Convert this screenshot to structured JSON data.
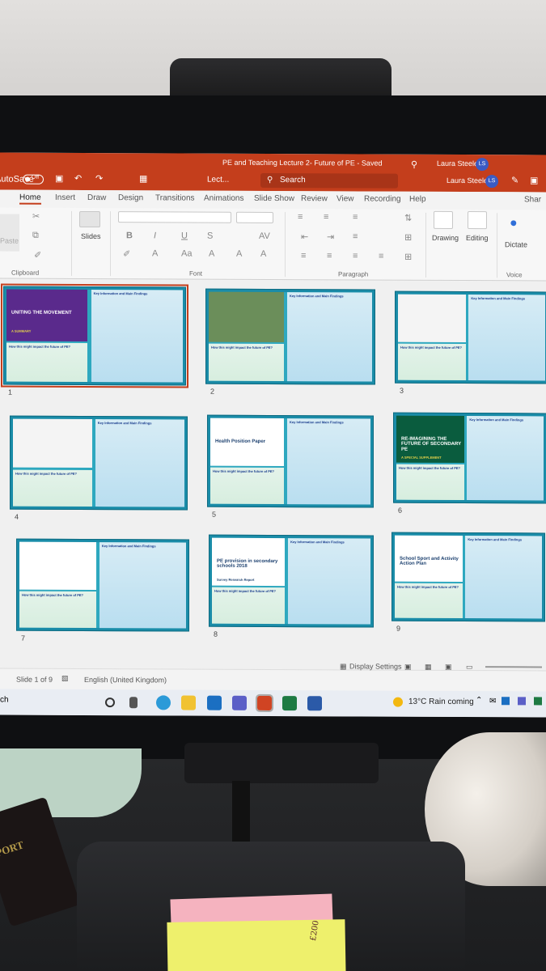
{
  "app": {
    "autosave_label": "AutoSave",
    "autosave_state": "Off",
    "doc_title": "PE and Teaching Lecture 2- Future of PE - Saved",
    "doc_dropdown": "Lect...",
    "search_placeholder": "Search",
    "user_name": "Laura Steele",
    "user_initials": "LS"
  },
  "ribbon": {
    "tabs": [
      "Home",
      "Insert",
      "Draw",
      "Design",
      "Transitions",
      "Animations",
      "Slide Show",
      "Review",
      "View",
      "Recording",
      "Help"
    ],
    "share_label": "Shar",
    "groups": {
      "clipboard": "Clipboard",
      "paste": "Paste",
      "slides": "Slides",
      "font": "Font",
      "paragraph": "Paragraph",
      "voice": "Voice"
    },
    "buttons": {
      "drawing": "Drawing",
      "editing": "Editing",
      "dictate": "Dictate"
    }
  },
  "slide_template": {
    "right_heading": "Key Information and Main Findings",
    "left_heading": "How this might impact the future of PE?"
  },
  "slides": [
    {
      "number": "1",
      "thumb_title": "UNITING THE MOVEMENT",
      "thumb_sub": "A SUMMARY"
    },
    {
      "number": "2",
      "thumb_title": "",
      "thumb_sub": ""
    },
    {
      "number": "3",
      "thumb_title": "",
      "thumb_sub": ""
    },
    {
      "number": "4",
      "thumb_title": "",
      "thumb_sub": ""
    },
    {
      "number": "5",
      "thumb_title": "Health Position Paper",
      "thumb_sub": ""
    },
    {
      "number": "6",
      "thumb_title": "RE-IMAGINING THE FUTURE OF SECONDARY PE",
      "thumb_sub": "A SPECIAL SUPPLEMENT"
    },
    {
      "number": "7",
      "thumb_title": "",
      "thumb_sub": ""
    },
    {
      "number": "8",
      "thumb_title": "PE provision in secondary schools 2018",
      "thumb_sub": "Survey Research Report"
    },
    {
      "number": "9",
      "thumb_title": "School Sport and Activity Action Plan",
      "thumb_sub": ""
    }
  ],
  "status": {
    "slide_of": "Slide 1 of 9",
    "language": "English (United Kingdom)",
    "display_settings": "Display Settings"
  },
  "taskbar": {
    "search_fragment": "ch",
    "weather": "13°C  Rain coming"
  },
  "desk": {
    "passport_text": "PORT",
    "note_text": "£200"
  },
  "colors": {
    "powerpoint_red": "#c43e1c",
    "slide_teal": "#1a8ca8"
  }
}
